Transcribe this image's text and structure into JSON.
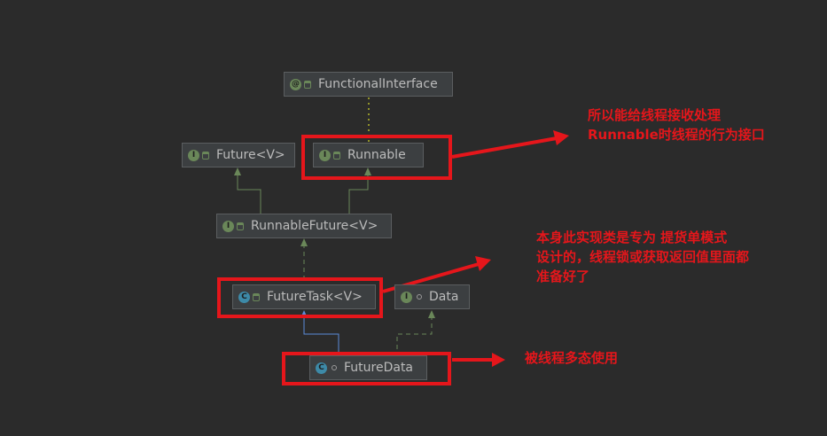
{
  "nodes": {
    "functional_interface": "FunctionalInterface",
    "future": "Future<V>",
    "runnable": "Runnable",
    "runnable_future": "RunnableFuture<V>",
    "future_task": "FutureTask<V>",
    "data": "Data",
    "future_data": "FutureData"
  },
  "badges": {
    "annotation": "@",
    "interface": "I",
    "class": "C"
  },
  "annotations": {
    "runnable_note": "所以能给线程接收处理\nRunnable时线程的行为接口",
    "future_task_note": "本身此实现类是专为 提货单模式\n设计的，线程锁或获取返回值里面都\n准备好了",
    "future_data_note": "被线程多态使用"
  },
  "colors": {
    "background": "#2b2b2b",
    "highlight": "#e5161b",
    "inherit_arrow": "#6a8759",
    "implement_line": "#5b8bd9"
  }
}
